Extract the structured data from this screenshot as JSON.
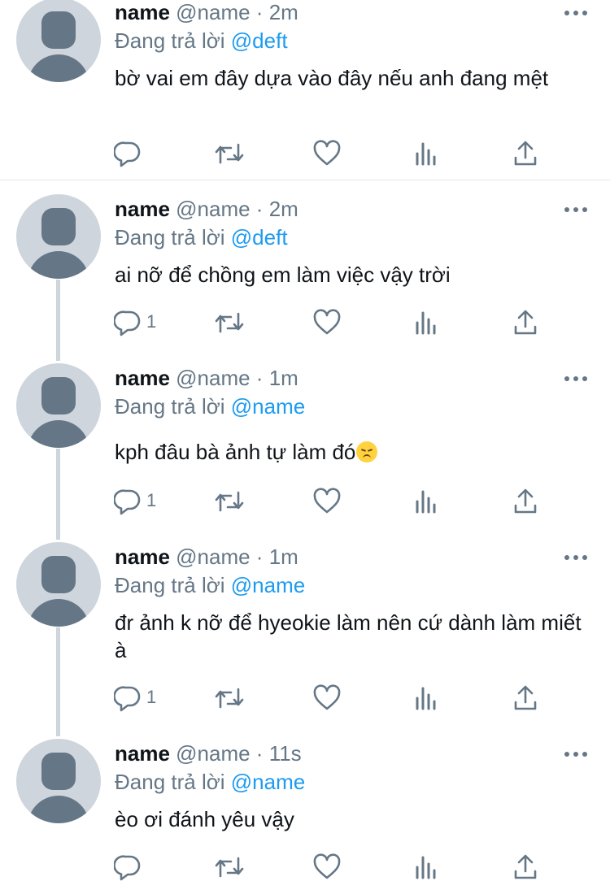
{
  "colors": {
    "name": "#0f1419",
    "meta": "#657786",
    "mention": "#1d9bf0",
    "avatar_bg": "#ced5dc",
    "avatar_fg": "#657786"
  },
  "icons": [
    "reply-icon",
    "retweet-icon",
    "like-icon",
    "analytics-icon",
    "share-icon",
    "more-icon",
    "avatar-icon"
  ],
  "tweets": [
    {
      "name": "name",
      "meta": "@name · 2m",
      "reply_prefix": "Đang trả lời ",
      "mention": "@deft",
      "text": "bờ vai em đây dựa vào đây nếu anh đang mệt",
      "reply_count": ""
    },
    {
      "name": "name",
      "meta": "@name · 2m",
      "reply_prefix": "Đang trả lời ",
      "mention": "@deft",
      "text": "ai nỡ để chồng em làm việc vậy trời",
      "reply_count": "1"
    },
    {
      "name": "name",
      "meta": "@name · 1m",
      "reply_prefix": "Đang trả lời ",
      "mention": "@name",
      "text": "kph đâu bà ảnh tự làm đó",
      "emoji": "disappointed-face",
      "reply_count": "1"
    },
    {
      "name": "name",
      "meta": "@name · 1m",
      "reply_prefix": "Đang trả lời ",
      "mention": "@name",
      "text": "đr ảnh k nỡ để hyeokie làm nên cứ dành làm miết à",
      "reply_count": "1"
    },
    {
      "name": "name",
      "meta": "@name · 11s",
      "reply_prefix": "Đang trả lời ",
      "mention": "@name",
      "text": "èo ơi đánh yêu vậy",
      "reply_count": ""
    }
  ]
}
